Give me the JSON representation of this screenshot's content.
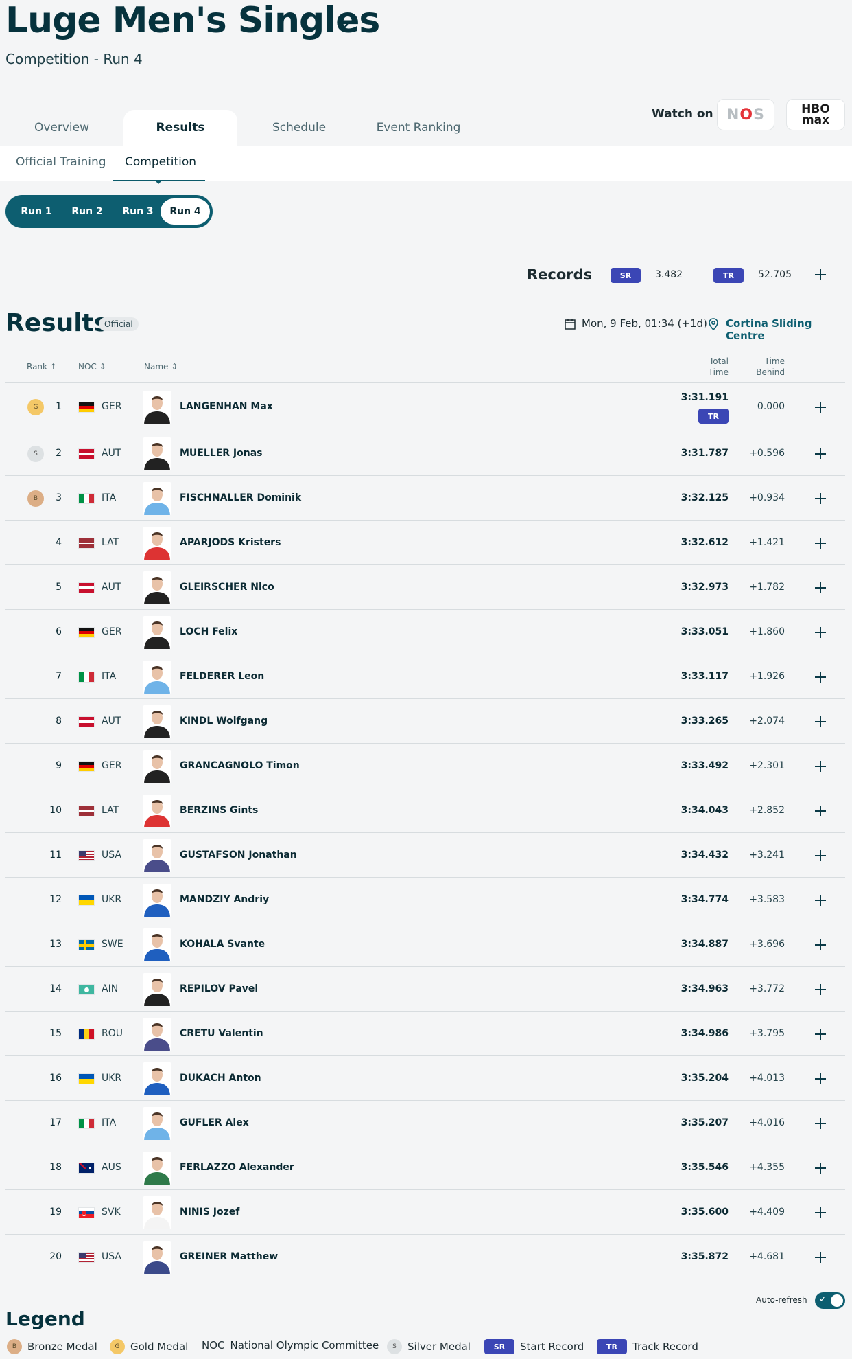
{
  "header": {
    "title": "Luge Men's Singles",
    "subtitle": "Competition - Run 4",
    "watch_label": "Watch on",
    "broadcasters": [
      "NOS",
      "HBO max"
    ]
  },
  "tabs": [
    "Overview",
    "Results",
    "Schedule",
    "Event Ranking"
  ],
  "subtabs": [
    "Official Training",
    "Competition"
  ],
  "runs": [
    "Run 1",
    "Run 2",
    "Run 3",
    "Run 4"
  ],
  "records": {
    "label": "Records",
    "sr_label": "SR",
    "sr_value": "3.482",
    "tr_label": "TR",
    "tr_value": "52.705"
  },
  "results": {
    "title": "Results",
    "status": "Official",
    "date": "Mon, 9 Feb, 01:34 (+1d)",
    "venue": "Cortina Sliding Centre",
    "columns": {
      "rank": "Rank",
      "noc": "NOC",
      "name": "Name",
      "total_1": "Total",
      "total_2": "Time",
      "behind_1": "Time",
      "behind_2": "Behind"
    },
    "rows": [
      {
        "rank": "1",
        "medal": "G",
        "noc": "GER",
        "name": "LANGENHAN Max",
        "total": "3:31.191",
        "behind": "0.000",
        "record": "TR"
      },
      {
        "rank": "2",
        "medal": "S",
        "noc": "AUT",
        "name": "MUELLER Jonas",
        "total": "3:31.787",
        "behind": "+0.596"
      },
      {
        "rank": "3",
        "medal": "B",
        "noc": "ITA",
        "name": "FISCHNALLER Dominik",
        "total": "3:32.125",
        "behind": "+0.934"
      },
      {
        "rank": "4",
        "noc": "LAT",
        "name": "APARJODS Kristers",
        "total": "3:32.612",
        "behind": "+1.421"
      },
      {
        "rank": "5",
        "noc": "AUT",
        "name": "GLEIRSCHER Nico",
        "total": "3:32.973",
        "behind": "+1.782"
      },
      {
        "rank": "6",
        "noc": "GER",
        "name": "LOCH Felix",
        "total": "3:33.051",
        "behind": "+1.860"
      },
      {
        "rank": "7",
        "noc": "ITA",
        "name": "FELDERER Leon",
        "total": "3:33.117",
        "behind": "+1.926"
      },
      {
        "rank": "8",
        "noc": "AUT",
        "name": "KINDL Wolfgang",
        "total": "3:33.265",
        "behind": "+2.074"
      },
      {
        "rank": "9",
        "noc": "GER",
        "name": "GRANCAGNOLO Timon",
        "total": "3:33.492",
        "behind": "+2.301"
      },
      {
        "rank": "10",
        "noc": "LAT",
        "name": "BERZINS Gints",
        "total": "3:34.043",
        "behind": "+2.852"
      },
      {
        "rank": "11",
        "noc": "USA",
        "name": "GUSTAFSON Jonathan",
        "total": "3:34.432",
        "behind": "+3.241"
      },
      {
        "rank": "12",
        "noc": "UKR",
        "name": "MANDZIY Andriy",
        "total": "3:34.774",
        "behind": "+3.583"
      },
      {
        "rank": "13",
        "noc": "SWE",
        "name": "KOHALA Svante",
        "total": "3:34.887",
        "behind": "+3.696"
      },
      {
        "rank": "14",
        "noc": "AIN",
        "name": "REPILOV Pavel",
        "total": "3:34.963",
        "behind": "+3.772"
      },
      {
        "rank": "15",
        "noc": "ROU",
        "name": "CRETU Valentin",
        "total": "3:34.986",
        "behind": "+3.795"
      },
      {
        "rank": "16",
        "noc": "UKR",
        "name": "DUKACH Anton",
        "total": "3:35.204",
        "behind": "+4.013"
      },
      {
        "rank": "17",
        "noc": "ITA",
        "name": "GUFLER Alex",
        "total": "3:35.207",
        "behind": "+4.016"
      },
      {
        "rank": "18",
        "noc": "AUS",
        "name": "FERLAZZO Alexander",
        "total": "3:35.546",
        "behind": "+4.355"
      },
      {
        "rank": "19",
        "noc": "SVK",
        "name": "NINIS Jozef",
        "total": "3:35.600",
        "behind": "+4.409"
      },
      {
        "rank": "20",
        "noc": "USA",
        "name": "GREINER Matthew",
        "total": "3:35.872",
        "behind": "+4.681"
      }
    ]
  },
  "auto_refresh": {
    "label": "Auto-refresh",
    "on": true
  },
  "legend": {
    "title": "Legend",
    "items": [
      {
        "badge": "B",
        "text": "Bronze Medal"
      },
      {
        "badge": "G",
        "text": "Gold Medal"
      },
      {
        "badge": "NOC",
        "text": "National Olympic Committee"
      },
      {
        "badge": "S",
        "text": "Silver Medal"
      },
      {
        "badge": "SR",
        "text": "Start Record"
      },
      {
        "badge": "TR",
        "text": "Track Record"
      }
    ]
  },
  "colors": {
    "primary": "#0d5e70",
    "heading": "#06323d",
    "record_badge": "#3b46b5",
    "gold": "#f4c867",
    "silver": "#dde1e3",
    "bronze": "#dcae86"
  }
}
